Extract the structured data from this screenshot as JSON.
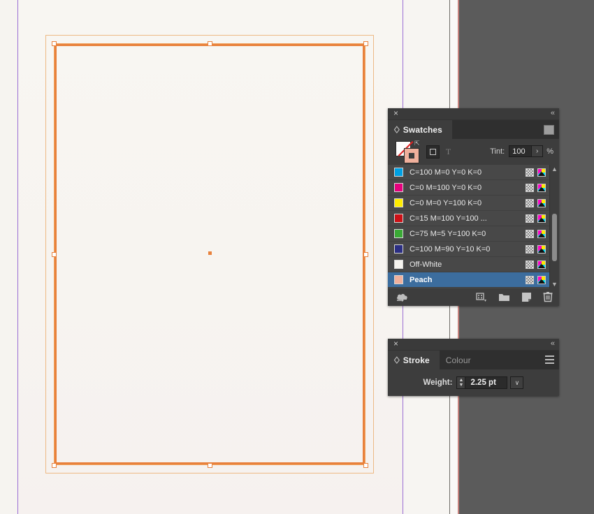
{
  "canvas": {
    "artboard_label": "artboard",
    "selection": {
      "stroke_color": "#e8813c",
      "bbox_color": "#f0a25c",
      "center_point_color": "#e8813c"
    },
    "guide_color": "#9b6fd4",
    "paper_color": "#f7f4f1",
    "workspace_color": "#5b5b5b"
  },
  "swatches_panel": {
    "tab_label": "Swatches",
    "close_label": "×",
    "collapse_label": "«",
    "tint": {
      "label": "Tint:",
      "value": "100",
      "unit": "%",
      "arrow": "›"
    },
    "fill_stroke": {
      "fill_name": "none-fill",
      "stroke_color": "#f0b09c"
    },
    "swatch_list_buttons": {
      "show_swatch_kinds": "show-swatch-kinds-button",
      "text_format": "T"
    },
    "swatches": [
      {
        "name": "C=100 M=0 Y=0 K=0",
        "color": "#00a0e3",
        "selected": false
      },
      {
        "name": "C=0 M=100 Y=0 K=0",
        "color": "#e5007d",
        "selected": false
      },
      {
        "name": "C=0 M=0 Y=100 K=0",
        "color": "#ffec00",
        "selected": false
      },
      {
        "name": "C=15 M=100 Y=100 ...",
        "color": "#cc1016",
        "selected": false
      },
      {
        "name": "C=75 M=5 Y=100 K=0",
        "color": "#3aa935",
        "selected": false
      },
      {
        "name": "C=100 M=90 Y=10 K=0",
        "color": "#2b2e83",
        "selected": false
      },
      {
        "name": "Off-White",
        "color": "#f5f3ee",
        "selected": false
      },
      {
        "name": "Peach",
        "color": "#f0b09c",
        "selected": true
      }
    ],
    "footer_buttons": [
      "libraries-icon",
      "swatch-kinds-menu-icon",
      "new-color-group-icon",
      "new-swatch-icon",
      "delete-swatch-icon"
    ]
  },
  "stroke_panel": {
    "tabs": [
      {
        "label": "Stroke",
        "active": true
      },
      {
        "label": "Colour",
        "active": false
      }
    ],
    "close_label": "×",
    "collapse_label": "«",
    "weight": {
      "label": "Weight:",
      "value": "2.25 pt",
      "caret": "∨"
    }
  }
}
